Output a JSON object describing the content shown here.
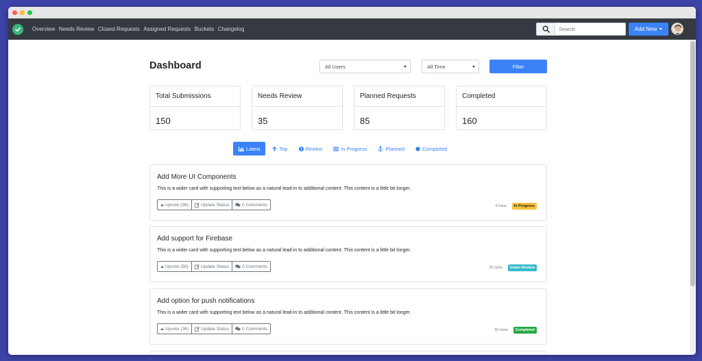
{
  "colors": {
    "accent": "#3b82f6",
    "navbar": "#343a40",
    "page_bg": "#3d44a8",
    "badge_in_progress": "#f6c23e",
    "badge_under_review": "#36b9cc",
    "badge_completed": "#28a745"
  },
  "nav": {
    "links": [
      "Overview",
      "Needs Review",
      "Closed Requests",
      "Assigned Requests",
      "Buckets",
      "Changelog"
    ],
    "search_placeholder": "Search",
    "add_new_label": "Add New"
  },
  "dashboard": {
    "title": "Dashboard",
    "user_filter": "All Users",
    "time_filter": "All Time",
    "filter_button": "Filter"
  },
  "stats": [
    {
      "label": "Total Submissions",
      "value": "150"
    },
    {
      "label": "Needs Review",
      "value": "35"
    },
    {
      "label": "Planned Requests",
      "value": "85"
    },
    {
      "label": "Completed",
      "value": "160"
    }
  ],
  "tabs": [
    {
      "label": "Latest",
      "icon": "bar-chart-icon"
    },
    {
      "label": "Top",
      "icon": "arrow-up-icon"
    },
    {
      "label": "Review",
      "icon": "exclamation-circle-icon"
    },
    {
      "label": "In Progress",
      "icon": "list-icon"
    },
    {
      "label": "Planned",
      "icon": "anchor-icon"
    },
    {
      "label": "Completed",
      "icon": "hexagon-icon"
    }
  ],
  "cards": [
    {
      "title": "Add More UI Components",
      "text": "This is a wider card with supporting text below as a natural lead-in to additional content. This content is a little bit longer.",
      "upvote": "Upvote (36)",
      "update": "Update Status",
      "comments": "0 Comments",
      "time": "9 mins",
      "status": "In Progress"
    },
    {
      "title": "Add support for Firebase",
      "text": "This is a wider card with supporting text below as a natural lead-in to additional content. This content is a little bit longer.",
      "upvote": "Upvote (56)",
      "update": "Update Status",
      "comments": "0 Comments",
      "time": "25 mins",
      "status": "Under Review"
    },
    {
      "title": "Add option for push notifications",
      "text": "This is a wider card with supporting text below as a natural lead-in to additional content. This content is a little bit longer.",
      "upvote": "Upvote (36)",
      "update": "Update Status",
      "comments": "0 Comments",
      "time": "50 mins",
      "status": "Completed"
    }
  ]
}
